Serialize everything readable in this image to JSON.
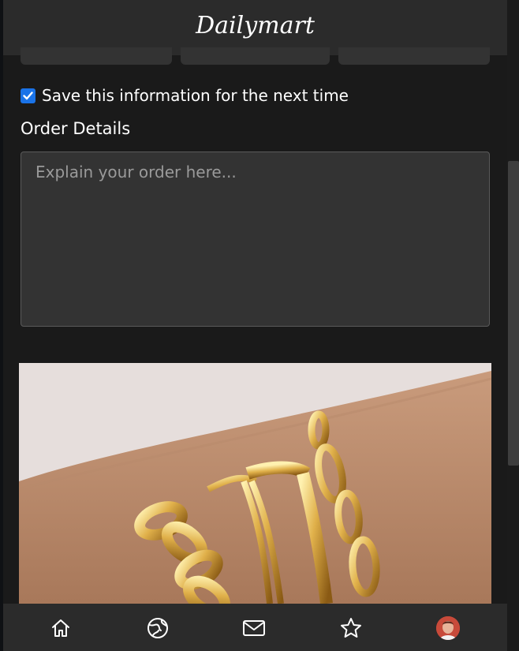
{
  "header": {
    "logo_text": "Dailymart"
  },
  "form": {
    "save_label": "Save this information for the next time",
    "save_checked": true,
    "order_details_title": "Order Details",
    "order_details_placeholder": "Explain your order here...",
    "order_details_value": ""
  },
  "bottom_nav": {
    "items": [
      {
        "name": "home",
        "icon": "home-icon"
      },
      {
        "name": "explore",
        "icon": "globe-icon"
      },
      {
        "name": "messages",
        "icon": "mail-icon"
      },
      {
        "name": "favorites",
        "icon": "star-icon"
      },
      {
        "name": "profile",
        "icon": "avatar"
      }
    ]
  },
  "colors": {
    "background": "#1a1a1a",
    "bar": "#2b2b2b",
    "field": "#333333",
    "checkbox": "#1a73e8"
  }
}
